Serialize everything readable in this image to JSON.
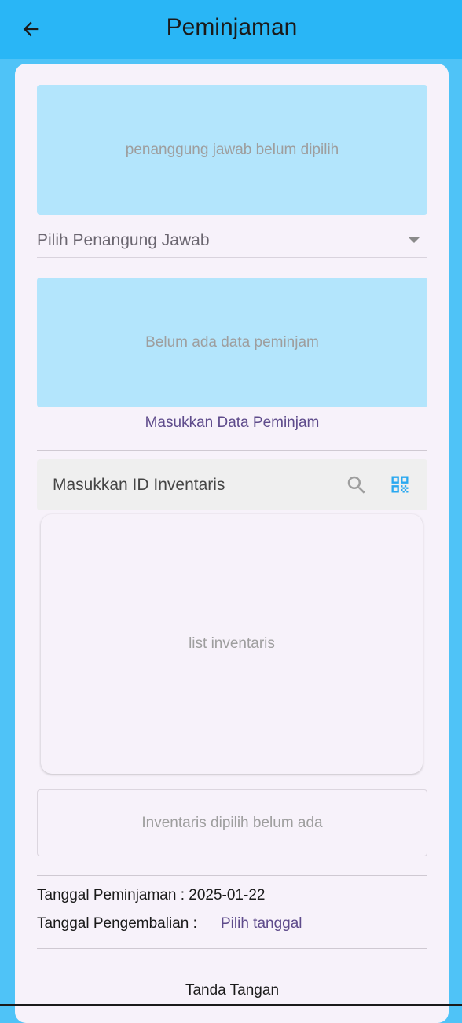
{
  "header": {
    "title": "Peminjaman",
    "back_icon": "arrow-left-icon"
  },
  "responsible": {
    "placeholder_panel": "penanggung jawab belum dipilih",
    "dropdown_label": "Pilih Penangung Jawab",
    "dropdown_icon": "caret-down-icon"
  },
  "borrower": {
    "placeholder_panel": "Belum ada data peminjam",
    "enter_button": "Masukkan Data Peminjam"
  },
  "inventory_search": {
    "placeholder": "Masukkan ID Inventaris",
    "search_icon": "search-icon",
    "scan_icon": "qr-code-icon"
  },
  "inventory_list": {
    "placeholder": "list inventaris"
  },
  "selected_inventory": {
    "placeholder": "Inventaris dipilih belum ada"
  },
  "dates": {
    "borrow_label": "Tanggal Peminjaman : 2025-01-22",
    "return_label": "Tanggal Pengembalian :",
    "return_picker": "Pilih tanggal"
  },
  "signature": {
    "title": "Tanda Tangan"
  },
  "colors": {
    "appbar": "#29b6f6",
    "background": "#4fc3f7",
    "panel": "#b3e5fc",
    "card": "#f7f2fa",
    "accent_link": "#5e4b8b",
    "qr_icon": "#29a8f0"
  }
}
